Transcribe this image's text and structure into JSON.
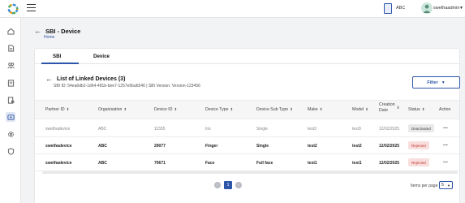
{
  "header": {
    "org_label": "ABC",
    "user_label": "swethaadmin",
    "org_icon": "building-icon",
    "user_caret_icon": "chevron-down-icon"
  },
  "sidebar": {
    "items": [
      {
        "icon": "home-icon"
      },
      {
        "icon": "document-icon"
      },
      {
        "icon": "users-icon"
      },
      {
        "icon": "report-icon"
      },
      {
        "icon": "certificate-icon"
      },
      {
        "icon": "device-icon",
        "active": true
      },
      {
        "icon": "settings-icon"
      },
      {
        "icon": "shield-icon"
      }
    ]
  },
  "page": {
    "title": "SBI - Device",
    "breadcrumb": "Home"
  },
  "tabs": [
    {
      "label": "SBI"
    },
    {
      "label": "Device",
      "active": true
    }
  ],
  "list": {
    "title": "List of Linked Devices (3)",
    "subtitle": "SBI ID: 54ea6db2-1d64-481b-bee7-1257e5ba6546 | SBI Version: Version-123456",
    "filter_label": "Filter"
  },
  "table": {
    "columns": [
      "Partner ID",
      "Organisation",
      "Device ID",
      "Device Type",
      "Device Sub Type",
      "Make",
      "Model",
      "Creation Date",
      "Status",
      "Action"
    ],
    "rows": [
      {
        "partner_id": "swethadevice",
        "organisation": "ABC",
        "device_id": "11555",
        "device_type": "Iris",
        "device_sub_type": "Single",
        "make": "test3",
        "model": "test3",
        "creation_date": "12/02/2025",
        "status": "Deactivated",
        "action": "..."
      },
      {
        "partner_id": "swethadevice",
        "organisation": "ABC",
        "device_id": "29077",
        "device_type": "Finger",
        "device_sub_type": "Single",
        "make": "test2",
        "model": "test2",
        "creation_date": "12/02/2025",
        "status": "Rejected",
        "action": "..."
      },
      {
        "partner_id": "swethadevice",
        "organisation": "ABC",
        "device_id": "70671",
        "device_type": "Face",
        "device_sub_type": "Full face",
        "make": "test1",
        "model": "test1",
        "creation_date": "12/02/2025",
        "status": "Rejected",
        "action": "..."
      }
    ]
  },
  "pagination": {
    "current_page": "1",
    "items_per_page_label": "Items per page",
    "items_per_page_value": "5"
  },
  "colors": {
    "accent": "#2d55a8",
    "rejected_bg": "#f9dede",
    "rejected_text": "#c0392b",
    "deactivated_bg": "#e9e9e9"
  }
}
